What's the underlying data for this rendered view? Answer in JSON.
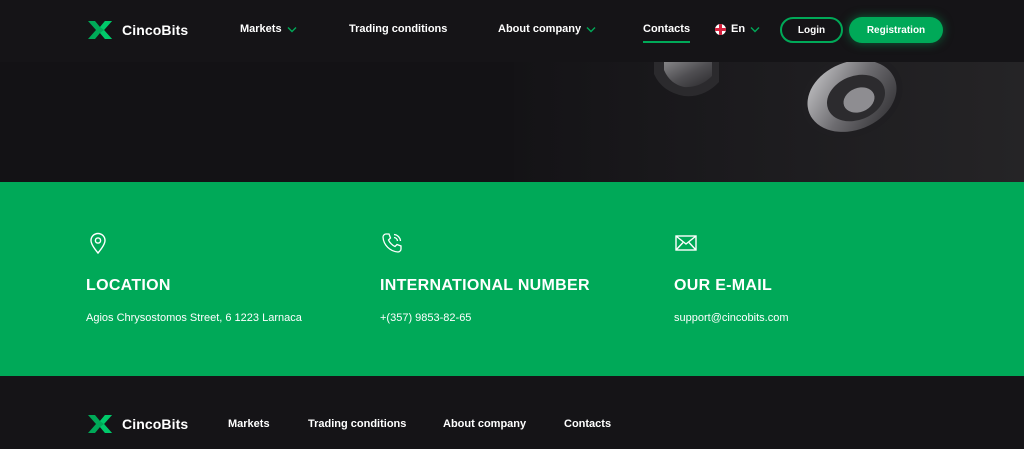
{
  "brand": {
    "name": "CincoBits",
    "accent": "#00a958"
  },
  "header": {
    "nav": [
      {
        "label": "Markets",
        "has_dropdown": true
      },
      {
        "label": "Trading conditions",
        "has_dropdown": false
      },
      {
        "label": "About company",
        "has_dropdown": true
      },
      {
        "label": "Contacts",
        "has_dropdown": false,
        "active": true
      }
    ],
    "language": {
      "label": "En",
      "flag": "uk-flag-icon"
    },
    "login_label": "Login",
    "registration_label": "Registration"
  },
  "contacts": [
    {
      "icon": "location-pin-icon",
      "title": "LOCATION",
      "value": "Agios Chrysostomos Street, 6 1223 Larnaca"
    },
    {
      "icon": "phone-icon",
      "title": "INTERNATIONAL NUMBER",
      "value": "+(357) 9853-82-65"
    },
    {
      "icon": "envelope-icon",
      "title": "OUR E-MAIL",
      "value": "support@cincobits.com"
    }
  ],
  "footer": {
    "nav": [
      {
        "label": "Markets"
      },
      {
        "label": "Trading conditions"
      },
      {
        "label": "About company"
      },
      {
        "label": "Contacts"
      }
    ]
  }
}
